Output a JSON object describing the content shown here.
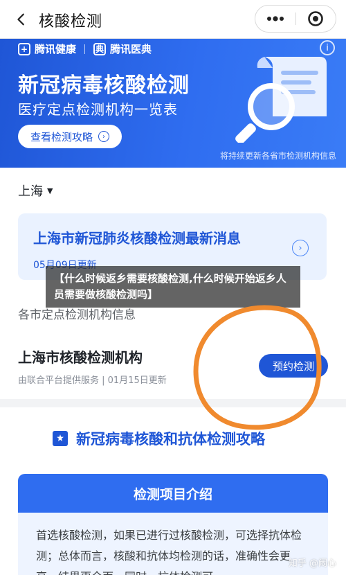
{
  "nav": {
    "title": "核酸检测"
  },
  "banner": {
    "brand_1": "腾讯健康",
    "brand_2": "腾讯医典",
    "title": "新冠病毒核酸检测",
    "subtitle": "医疗定点检测机构一览表",
    "button_label": "查看检测攻略",
    "note": "将持续更新各省市检测机构信息"
  },
  "location": {
    "city": "上海"
  },
  "news": {
    "title": "上海市新冠肺炎核酸检测最新消息",
    "date": "05月09日更新"
  },
  "institutions": {
    "section_label": "各市定点检测机构信息",
    "title": "上海市核酸检测机构",
    "subtitle": "由联合平台提供服务 | 01月15日更新",
    "book_button": "预约检测"
  },
  "guide": {
    "title": "新冠病毒核酸和抗体检测攻略",
    "card_title": "检测项目介绍",
    "card_text": "首选核酸检测，如果已进行过核酸检测，可选择抗体检测；总体而言，核酸和抗体均检测的话，准确性会更高，结果更全面。同时，抗体检测可"
  },
  "overlay": {
    "headline": "【什么时候返乡需要核酸检测,什么时候开始返乡人员需要做核酸检测吗】",
    "watermark": "知乎 @阚心"
  },
  "colors": {
    "brand_blue": "#1f56d6",
    "card_blue": "#eaf2ff",
    "circle_orange": "#f08a2e"
  },
  "icons": [
    "back-arrow-icon",
    "more-dots-icon",
    "close-target-icon",
    "info-icon",
    "chevron-right-icon",
    "caret-down-icon",
    "bookmark-star-icon"
  ]
}
